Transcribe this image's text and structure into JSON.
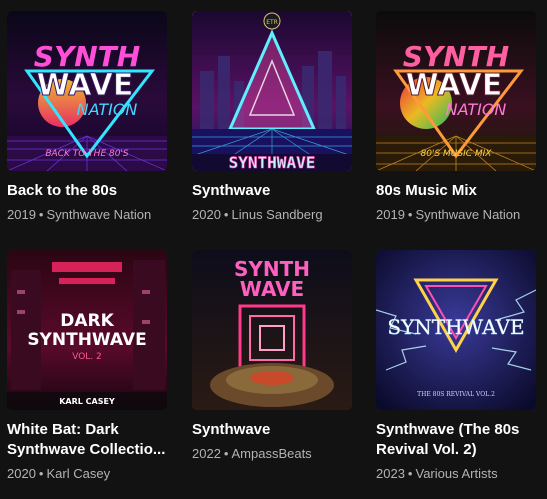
{
  "albums": [
    {
      "title": "Back to the 80s",
      "year": "2019",
      "artist": "Synthwave Nation",
      "cover_text_top": "SYNTH",
      "cover_text_mid": "WAVE",
      "cover_text_low": "NATION",
      "cover_caption": "BACK TO THE 80'S"
    },
    {
      "title": "Synthwave",
      "year": "2020",
      "artist": "Linus Sandberg",
      "cover_text": "SYNTHWAVE",
      "cover_badge": "ETR"
    },
    {
      "title": "80s Music Mix",
      "year": "2019",
      "artist": "Synthwave Nation",
      "cover_text_top": "SYNTH",
      "cover_text_mid": "WAVE",
      "cover_text_low": "NATION",
      "cover_caption": "80'S MUSIC MIX"
    },
    {
      "title": "White Bat: Dark Synthwave Collectio...",
      "year": "2020",
      "artist": "Karl Casey",
      "cover_text_top": "DARK",
      "cover_text_mid": "SYNTHWAVE",
      "cover_text_low": "VOL. 2",
      "cover_caption": "KARL CASEY"
    },
    {
      "title": "Synthwave",
      "year": "2022",
      "artist": "AmpassBeats",
      "cover_text_top": "SYNTH",
      "cover_text_mid": "WAVE"
    },
    {
      "title": "Synthwave (The 80s Revival Vol. 2)",
      "year": "2023",
      "artist": "Various Artists",
      "cover_text": "SYNTHWAVE",
      "cover_caption": "THE 80S REVIVAL VOL.2"
    }
  ],
  "separator": "•"
}
